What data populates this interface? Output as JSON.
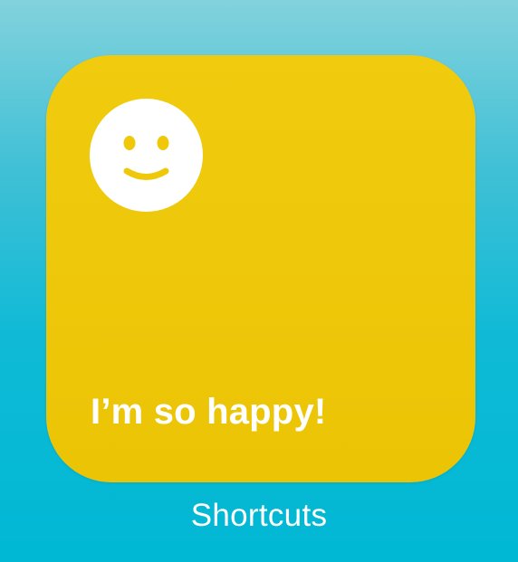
{
  "widget": {
    "title": "I’m so happy!",
    "icon": "smiley-face-icon",
    "background_color": "#efc80a",
    "icon_color": "#efc80a"
  },
  "app_label": "Shortcuts",
  "background_color": "#00b8d4"
}
